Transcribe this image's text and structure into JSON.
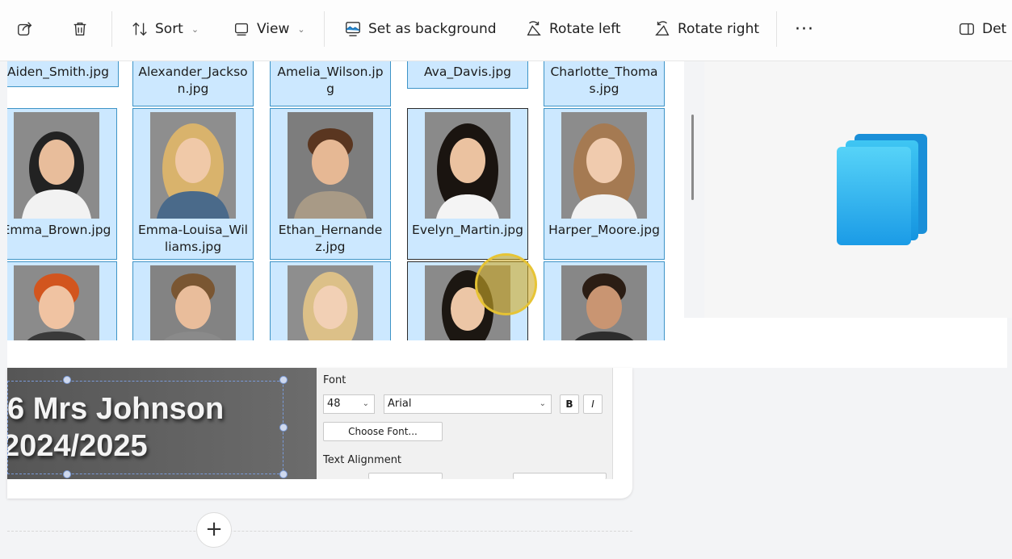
{
  "toolbar": {
    "sort_label": "Sort",
    "view_label": "View",
    "set_background_label": "Set as background",
    "rotate_left_label": "Rotate left",
    "rotate_right_label": "Rotate right",
    "more_label": "···",
    "details_label": "Det"
  },
  "files": {
    "row1": [
      "Aiden_Smith.jpg",
      "Alexander_Jackson.jpg",
      "Amelia_Wilson.jpg",
      "Ava_Davis.jpg",
      "Charlotte_Thomas.jpg"
    ],
    "row2": [
      "Emma_Brown.jpg",
      "Emma-Louisa_Williams.jpg",
      "Ethan_Hernandez.jpg",
      "Evelyn_Martin.jpg",
      "Harper_Moore.jpg"
    ],
    "focused": "Evelyn_Martin.jpg"
  },
  "editor": {
    "banner_line1": "6 Mrs Johnson",
    "banner_line2": "2024/2025",
    "font_label": "Font",
    "font_size": "48",
    "font_name": "Arial",
    "bold_label": "B",
    "italic_label": "I",
    "choose_font_label": "Choose Font...",
    "text_alignment_label": "Text Alignment",
    "add_label": "+"
  },
  "colors": {
    "tile_selected_bg": "#cce8ff",
    "tile_border": "#3e94c7",
    "cursor_highlight": "#e8c432",
    "stack_icon_top": "#33c3f0"
  },
  "icons": [
    "share-icon",
    "delete-icon",
    "sort-icon",
    "view-icon",
    "set-background-icon",
    "rotate-left-icon",
    "rotate-right-icon",
    "details-pane-icon",
    "file-stack-icon"
  ]
}
